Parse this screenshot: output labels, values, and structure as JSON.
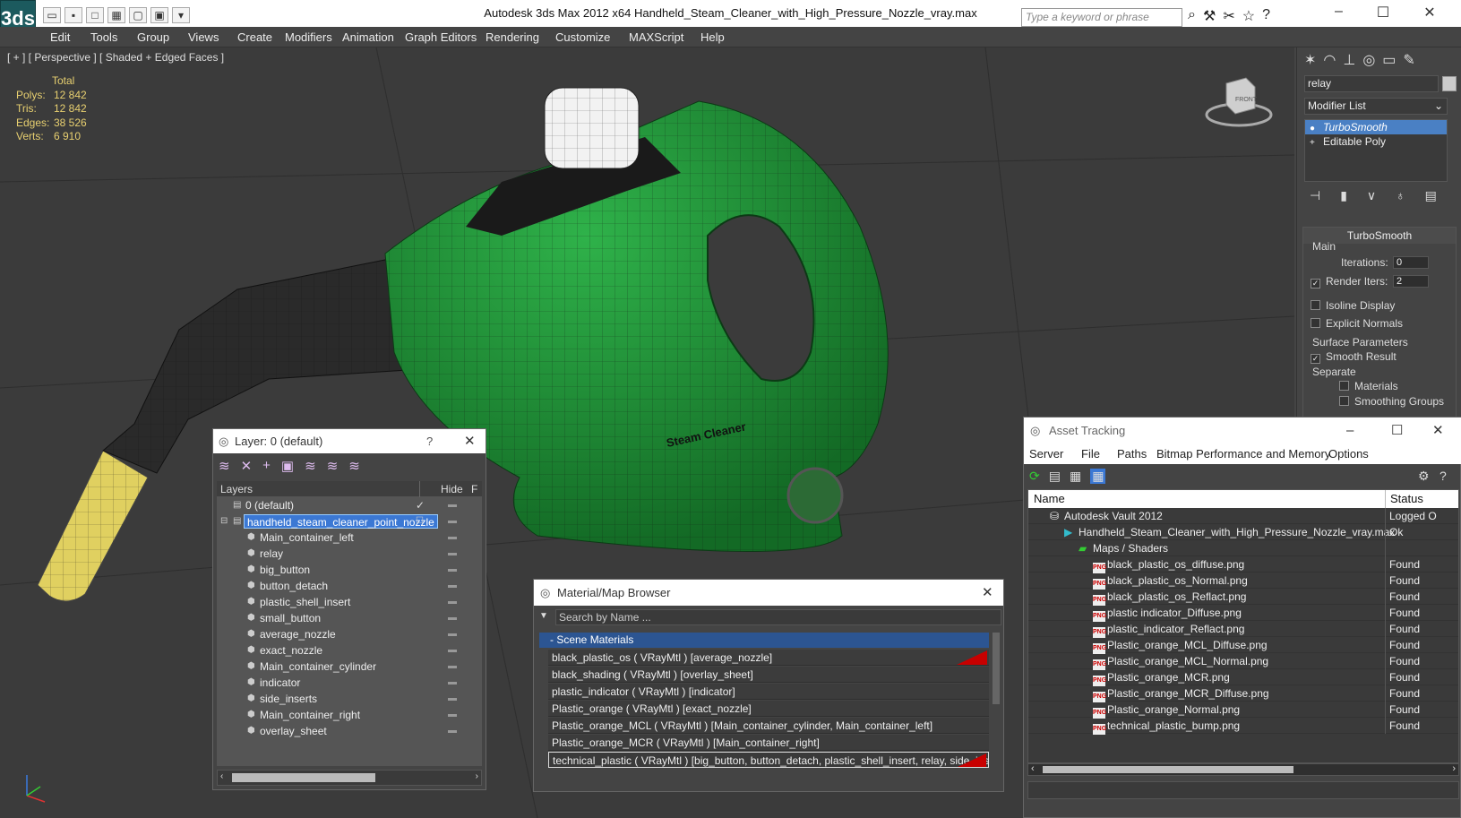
{
  "window": {
    "app_logo": "3ds",
    "title": "Autodesk 3ds Max  2012 x64      Handheld_Steam_Cleaner_with_High_Pressure_Nozzle_vray.max",
    "search_placeholder": "Type a keyword or phrase"
  },
  "menu": [
    "Edit",
    "Tools",
    "Group",
    "Views",
    "Create",
    "Modifiers",
    "Animation",
    "Graph Editors",
    "Rendering",
    "Customize",
    "MAXScript",
    "Help"
  ],
  "viewport": {
    "label": "[ + ] [ Perspective ] [ Shaded + Edged Faces ]",
    "stats": {
      "header": "Total",
      "rows": [
        {
          "label": "Polys:",
          "value": "12 842"
        },
        {
          "label": "Tris:",
          "value": "12 842"
        },
        {
          "label": "Edges:",
          "value": "38 526"
        },
        {
          "label": "Verts:",
          "value": "6 910"
        }
      ]
    },
    "viewcube_label": "FRONT",
    "model_decal": "Steam Cleaner",
    "colors": {
      "body": "#1f8a34",
      "nozzle": "#e0d060",
      "dark": "#2a2a2a"
    }
  },
  "command_panel": {
    "object_name": "relay",
    "modifier_list": "Modifier List",
    "stack": [
      "TurboSmooth",
      "Editable Poly"
    ],
    "rollout": {
      "title": "TurboSmooth",
      "main_label": "Main",
      "iterations_label": "Iterations:",
      "iterations_value": "0",
      "render_iters_label": "Render Iters:",
      "render_iters_value": "2",
      "isoline": "Isoline Display",
      "explicit_normals": "Explicit Normals",
      "surface_params": "Surface Parameters",
      "smooth_result": "Smooth Result",
      "separate": "Separate",
      "materials": "Materials",
      "smoothing_groups": "Smoothing Groups"
    }
  },
  "layer_dialog": {
    "title": "Layer: 0 (default)",
    "help": "?",
    "col_layers": "Layers",
    "col_hide": "Hide",
    "col_f": "F",
    "rows": [
      {
        "name": "0 (default)",
        "level": 0,
        "selected": false
      },
      {
        "name": "handheld_steam_cleaner_point_nozzle",
        "level": 0,
        "selected": true
      },
      {
        "name": "Main_container_left",
        "level": 1,
        "selected": false
      },
      {
        "name": "relay",
        "level": 1,
        "selected": false
      },
      {
        "name": "big_button",
        "level": 1,
        "selected": false
      },
      {
        "name": "button_detach",
        "level": 1,
        "selected": false
      },
      {
        "name": "plastic_shell_insert",
        "level": 1,
        "selected": false
      },
      {
        "name": "small_button",
        "level": 1,
        "selected": false
      },
      {
        "name": "average_nozzle",
        "level": 1,
        "selected": false
      },
      {
        "name": "exact_nozzle",
        "level": 1,
        "selected": false
      },
      {
        "name": "Main_container_cylinder",
        "level": 1,
        "selected": false
      },
      {
        "name": "indicator",
        "level": 1,
        "selected": false
      },
      {
        "name": "side_inserts",
        "level": 1,
        "selected": false
      },
      {
        "name": "Main_container_right",
        "level": 1,
        "selected": false
      },
      {
        "name": "overlay_sheet",
        "level": 1,
        "selected": false
      }
    ]
  },
  "material_browser": {
    "title": "Material/Map Browser",
    "search_placeholder": "Search by Name ...",
    "group": "- Scene Materials",
    "rows": [
      "black_plastic_os  ( VRayMtl ) [average_nozzle]",
      "black_shading  ( VRayMtl ) [overlay_sheet]",
      "plastic_indicator  ( VRayMtl ) [indicator]",
      "Plastic_orange  ( VRayMtl ) [exact_nozzle]",
      "Plastic_orange_MCL  ( VRayMtl ) [Main_container_cylinder, Main_container_left]",
      "Plastic_orange_MCR  ( VRayMtl ) [Main_container_right]",
      "technical_plastic  ( VRayMtl ) [big_button, button_detach, plastic_shell_insert, relay, side_insert..."
    ]
  },
  "asset_tracking": {
    "title": "Asset Tracking",
    "menu": [
      "Server",
      "File",
      "Paths",
      "Bitmap Performance and Memory",
      "Options"
    ],
    "col_name": "Name",
    "col_status": "Status",
    "rows": [
      {
        "name": "Autodesk Vault 2012",
        "status": "Logged O",
        "level": 1,
        "icon": "vault"
      },
      {
        "name": "Handheld_Steam_Cleaner_with_High_Pressure_Nozzle_vray.max",
        "status": "Ok",
        "level": 2,
        "icon": "max"
      },
      {
        "name": "Maps / Shaders",
        "status": "",
        "level": 3,
        "icon": "maps"
      },
      {
        "name": "black_plastic_os_diffuse.png",
        "status": "Found",
        "level": 4,
        "icon": "png"
      },
      {
        "name": "black_plastic_os_Normal.png",
        "status": "Found",
        "level": 4,
        "icon": "png"
      },
      {
        "name": "black_plastic_os_Reflact.png",
        "status": "Found",
        "level": 4,
        "icon": "png"
      },
      {
        "name": "plastic indicator_Diffuse.png",
        "status": "Found",
        "level": 4,
        "icon": "png"
      },
      {
        "name": "plastic_indicator_Reflact.png",
        "status": "Found",
        "level": 4,
        "icon": "png"
      },
      {
        "name": "Plastic_orange_MCL_Diffuse.png",
        "status": "Found",
        "level": 4,
        "icon": "png"
      },
      {
        "name": "Plastic_orange_MCL_Normal.png",
        "status": "Found",
        "level": 4,
        "icon": "png"
      },
      {
        "name": "Plastic_orange_MCR.png",
        "status": "Found",
        "level": 4,
        "icon": "png"
      },
      {
        "name": "Plastic_orange_MCR_Diffuse.png",
        "status": "Found",
        "level": 4,
        "icon": "png"
      },
      {
        "name": "Plastic_orange_Normal.png",
        "status": "Found",
        "level": 4,
        "icon": "png"
      },
      {
        "name": "technical_plastic_bump.png",
        "status": "Found",
        "level": 4,
        "icon": "png"
      }
    ]
  }
}
